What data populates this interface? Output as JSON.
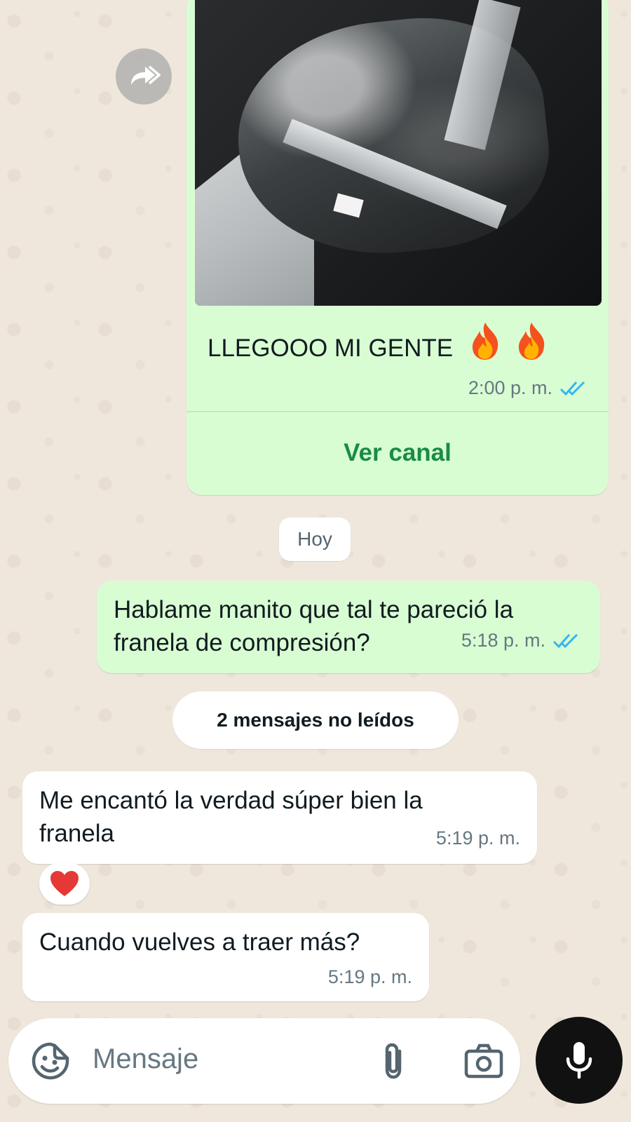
{
  "channel_post": {
    "text": "LLEGOOO MI GENTE",
    "time": "2:00 p. m.",
    "view_channel_label": "Ver canal"
  },
  "date_separator": "Hoy",
  "outgoing_message": {
    "line1": "Hablame manito que tal te pareció la",
    "line2": "franela de compresión?",
    "time": "5:18 p. m."
  },
  "unread_banner": "2 mensajes no leídos",
  "incoming_messages": [
    {
      "line1": "Me encantó la verdad súper bien la",
      "line2": "franela",
      "time": "5:19 p. m.",
      "reaction": "red-heart"
    },
    {
      "line1": "Cuando vuelves a traer más?",
      "time": "5:19 p. m."
    }
  ],
  "composer": {
    "placeholder": "Mensaje"
  },
  "colors": {
    "outgoing_bubble": "#d9fdd3",
    "incoming_bubble": "#ffffff",
    "read_ticks": "#34b7f1",
    "accent_green": "#1a8b4a",
    "wallpaper": "#efe7dc"
  },
  "icons": [
    "forward-icon",
    "fire-emoji",
    "double-check-icon",
    "heart-emoji",
    "sticker-icon",
    "paperclip-icon",
    "camera-icon",
    "microphone-icon"
  ]
}
